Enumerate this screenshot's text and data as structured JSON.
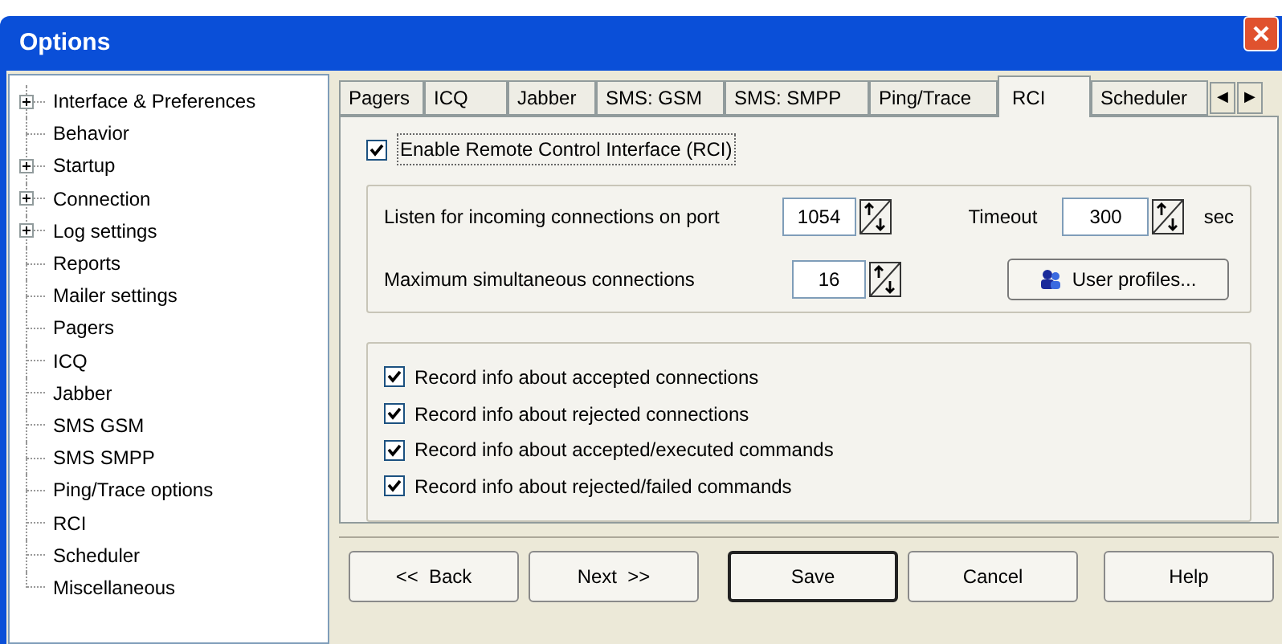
{
  "window": {
    "title": "Options"
  },
  "tree": [
    {
      "label": "Interface & Preferences",
      "kind": "group"
    },
    {
      "label": "Behavior",
      "kind": "leaf"
    },
    {
      "label": "Startup",
      "kind": "group"
    },
    {
      "label": "Connection",
      "kind": "group"
    },
    {
      "label": "Log settings",
      "kind": "group"
    },
    {
      "label": "Reports",
      "kind": "leaf"
    },
    {
      "label": "Mailer settings",
      "kind": "leaf"
    },
    {
      "label": "Pagers",
      "kind": "leaf"
    },
    {
      "label": "ICQ",
      "kind": "leaf"
    },
    {
      "label": "Jabber",
      "kind": "leaf"
    },
    {
      "label": "SMS GSM",
      "kind": "leaf"
    },
    {
      "label": "SMS SMPP",
      "kind": "leaf"
    },
    {
      "label": "Ping/Trace options",
      "kind": "leaf"
    },
    {
      "label": "RCI",
      "kind": "leaf"
    },
    {
      "label": "Scheduler",
      "kind": "leaf"
    },
    {
      "label": "Miscellaneous",
      "kind": "leaf"
    }
  ],
  "tabs": [
    {
      "label": "Pagers",
      "selected": false
    },
    {
      "label": "ICQ",
      "selected": false
    },
    {
      "label": "Jabber",
      "selected": false
    },
    {
      "label": "SMS: GSM",
      "selected": false
    },
    {
      "label": "SMS: SMPP",
      "selected": false
    },
    {
      "label": "Ping/Trace",
      "selected": false
    },
    {
      "label": "RCI",
      "selected": true
    },
    {
      "label": "Scheduler",
      "selected": false
    }
  ],
  "tab_scroll": [
    "◀",
    "▶"
  ],
  "enable": {
    "label": "Enable Remote Control Interface (RCI)",
    "checked": true
  },
  "port": {
    "label": "Listen for incoming connections on port",
    "value": "1054"
  },
  "timeout": {
    "label": "Timeout",
    "value": "300",
    "unit": "sec"
  },
  "max_connections": {
    "label": "Maximum simultaneous connections",
    "value": "16"
  },
  "user_profiles_button": "User profiles...",
  "record_options": [
    {
      "label": "Record info about accepted connections",
      "checked": true
    },
    {
      "label": "Record info about rejected connections",
      "checked": true
    },
    {
      "label": "Record info about accepted/executed commands",
      "checked": true
    },
    {
      "label": "Record info about rejected/failed commands",
      "checked": true
    }
  ],
  "buttons": [
    {
      "label": "<<  Back",
      "default": false
    },
    {
      "label": "Next  >>",
      "default": false
    },
    {
      "label": "Save",
      "default": true
    },
    {
      "label": "Cancel",
      "default": false
    },
    {
      "label": "Help",
      "default": false
    }
  ]
}
